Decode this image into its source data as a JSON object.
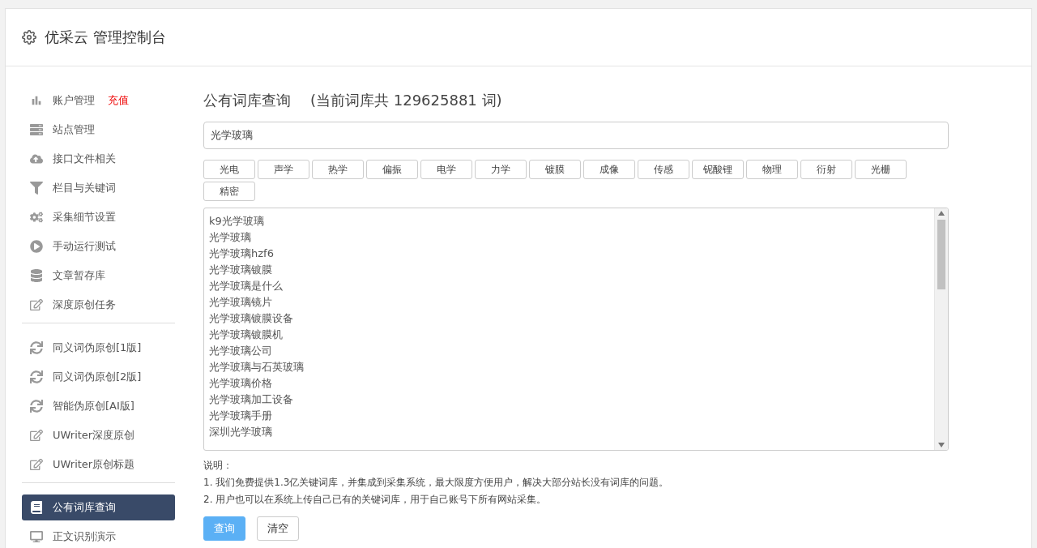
{
  "header": {
    "title": "优采云 管理控制台"
  },
  "sidebar": {
    "groups": [
      [
        {
          "label": "账户管理",
          "badge": "充值",
          "selected": false
        },
        {
          "label": "站点管理",
          "selected": false
        },
        {
          "label": "接口文件相关",
          "selected": false
        },
        {
          "label": "栏目与关键词",
          "selected": false
        },
        {
          "label": "采集细节设置",
          "selected": false
        },
        {
          "label": "手动运行测试",
          "selected": false
        },
        {
          "label": "文章暂存库",
          "selected": false
        },
        {
          "label": "深度原创任务",
          "selected": false
        }
      ],
      [
        {
          "label": "同义词伪原创[1版]",
          "selected": false
        },
        {
          "label": "同义词伪原创[2版]",
          "selected": false
        },
        {
          "label": "智能伪原创[AI版]",
          "selected": false
        },
        {
          "label": "UWriter深度原创",
          "selected": false
        },
        {
          "label": "UWriter原创标题",
          "selected": false
        }
      ],
      [
        {
          "label": "公有词库查询",
          "selected": true
        },
        {
          "label": "正文识别演示",
          "selected": false
        }
      ]
    ]
  },
  "main": {
    "title": "公有词库查询",
    "count": "(当前词库共 129625881 词)",
    "search": {
      "value": "光学玻璃"
    },
    "tags": [
      "光电",
      "声学",
      "热学",
      "偏振",
      "电学",
      "力学",
      "镀膜",
      "成像",
      "传感",
      "铌酸锂",
      "物理",
      "衍射",
      "光栅",
      "精密"
    ],
    "results": [
      "k9光学玻璃",
      "光学玻璃",
      "光学玻璃hzf6",
      "光学玻璃镀膜",
      "光学玻璃是什么",
      "光学玻璃镜片",
      "光学玻璃镀膜设备",
      "光学玻璃镀膜机",
      "光学玻璃公司",
      "光学玻璃与石英玻璃",
      "光学玻璃价格",
      "光学玻璃加工设备",
      "光学玻璃手册",
      "深圳光学玻璃"
    ],
    "notes_title": "说明：",
    "notes": [
      "1. 我们免费提供1.3亿关键词库，并集成到采集系统，最大限度方便用户，解决大部分站长没有词库的问题。",
      "2. 用户也可以在系统上传自己已有的关键词库，用于自己账号下所有网站采集。"
    ],
    "buttons": [
      {
        "label": "查询",
        "kind": "primary"
      },
      {
        "label": "清空",
        "kind": "default"
      }
    ]
  }
}
